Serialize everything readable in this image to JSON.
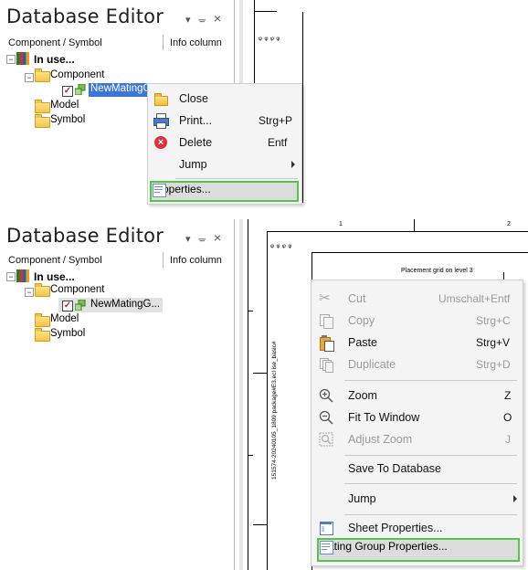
{
  "colors": {
    "title": "#1e1e1e",
    "selection": "#3c77d8",
    "highlight_border": "#55c44a",
    "menu_bg": "#f4f4f4"
  },
  "top": {
    "panel": {
      "title": "Database Editor",
      "dropdown_icon": "▾",
      "pin_icon": "ᚚ",
      "close_icon": "×"
    },
    "columns": {
      "component_symbol": "Component / Symbol",
      "info": "Info column"
    },
    "tree": {
      "in_use": "In use...",
      "component": "Component",
      "item": "NewMatingG",
      "model": "Model",
      "symbol": "Symbol"
    },
    "canvas": {
      "markers": "ᵠ ᵠ ᵠ ᵠ"
    },
    "menu": {
      "items": [
        {
          "label": "Close",
          "shortcut": "",
          "icon": "folder-open-icon"
        },
        {
          "label": "Print...",
          "shortcut": "Strg+P",
          "icon": "printer-icon"
        },
        {
          "label": "Delete",
          "shortcut": "Entf",
          "icon": "delete-icon"
        },
        {
          "label": "Jump",
          "shortcut": "",
          "icon": ""
        },
        {
          "label": "Properties...",
          "shortcut": "",
          "icon": "properties-icon"
        }
      ]
    }
  },
  "bottom": {
    "panel": {
      "title": "Database Editor",
      "dropdown_icon": "▾",
      "pin_icon": "ᚚ",
      "close_icon": "×"
    },
    "columns": {
      "component_symbol": "Component / Symbol",
      "info": "Info column"
    },
    "tree": {
      "in_use": "In use...",
      "component": "Component",
      "item": "NewMatingG...",
      "model": "Model",
      "symbol": "Symbol"
    },
    "canvas": {
      "grid_label": "Placement grid on level 3",
      "vertical_text": "151574-20240105_1809 package#E3.ecl ise_basic#",
      "col_1": "1",
      "col_2": "2"
    },
    "menu": {
      "items": [
        {
          "label": "Cut",
          "shortcut": "Umschalt+Entf",
          "disabled": true,
          "icon": "scissors-icon"
        },
        {
          "label": "Copy",
          "shortcut": "Strg+C",
          "disabled": true,
          "icon": "copy-icon"
        },
        {
          "label": "Paste",
          "shortcut": "Strg+V",
          "disabled": false,
          "icon": "paste-icon"
        },
        {
          "label": "Duplicate",
          "shortcut": "Strg+D",
          "disabled": true,
          "icon": "duplicate-icon"
        },
        {
          "label": "Zoom",
          "shortcut": "Z",
          "disabled": false,
          "icon": "zoom-in-icon"
        },
        {
          "label": "Fit To Window",
          "shortcut": "O",
          "disabled": false,
          "icon": "zoom-fit-icon"
        },
        {
          "label": "Adjust Zoom",
          "shortcut": "J",
          "disabled": true,
          "icon": "adjust-zoom-icon"
        },
        {
          "label": "Save To Database",
          "shortcut": "",
          "disabled": false,
          "icon": ""
        },
        {
          "label": "Jump",
          "shortcut": "",
          "disabled": false,
          "icon": ""
        },
        {
          "label": "Sheet Properties...",
          "shortcut": "",
          "disabled": false,
          "icon": "sheet-properties-icon"
        },
        {
          "label": "Mating Group Properties...",
          "shortcut": "",
          "disabled": false,
          "icon": "properties-icon"
        }
      ]
    }
  }
}
